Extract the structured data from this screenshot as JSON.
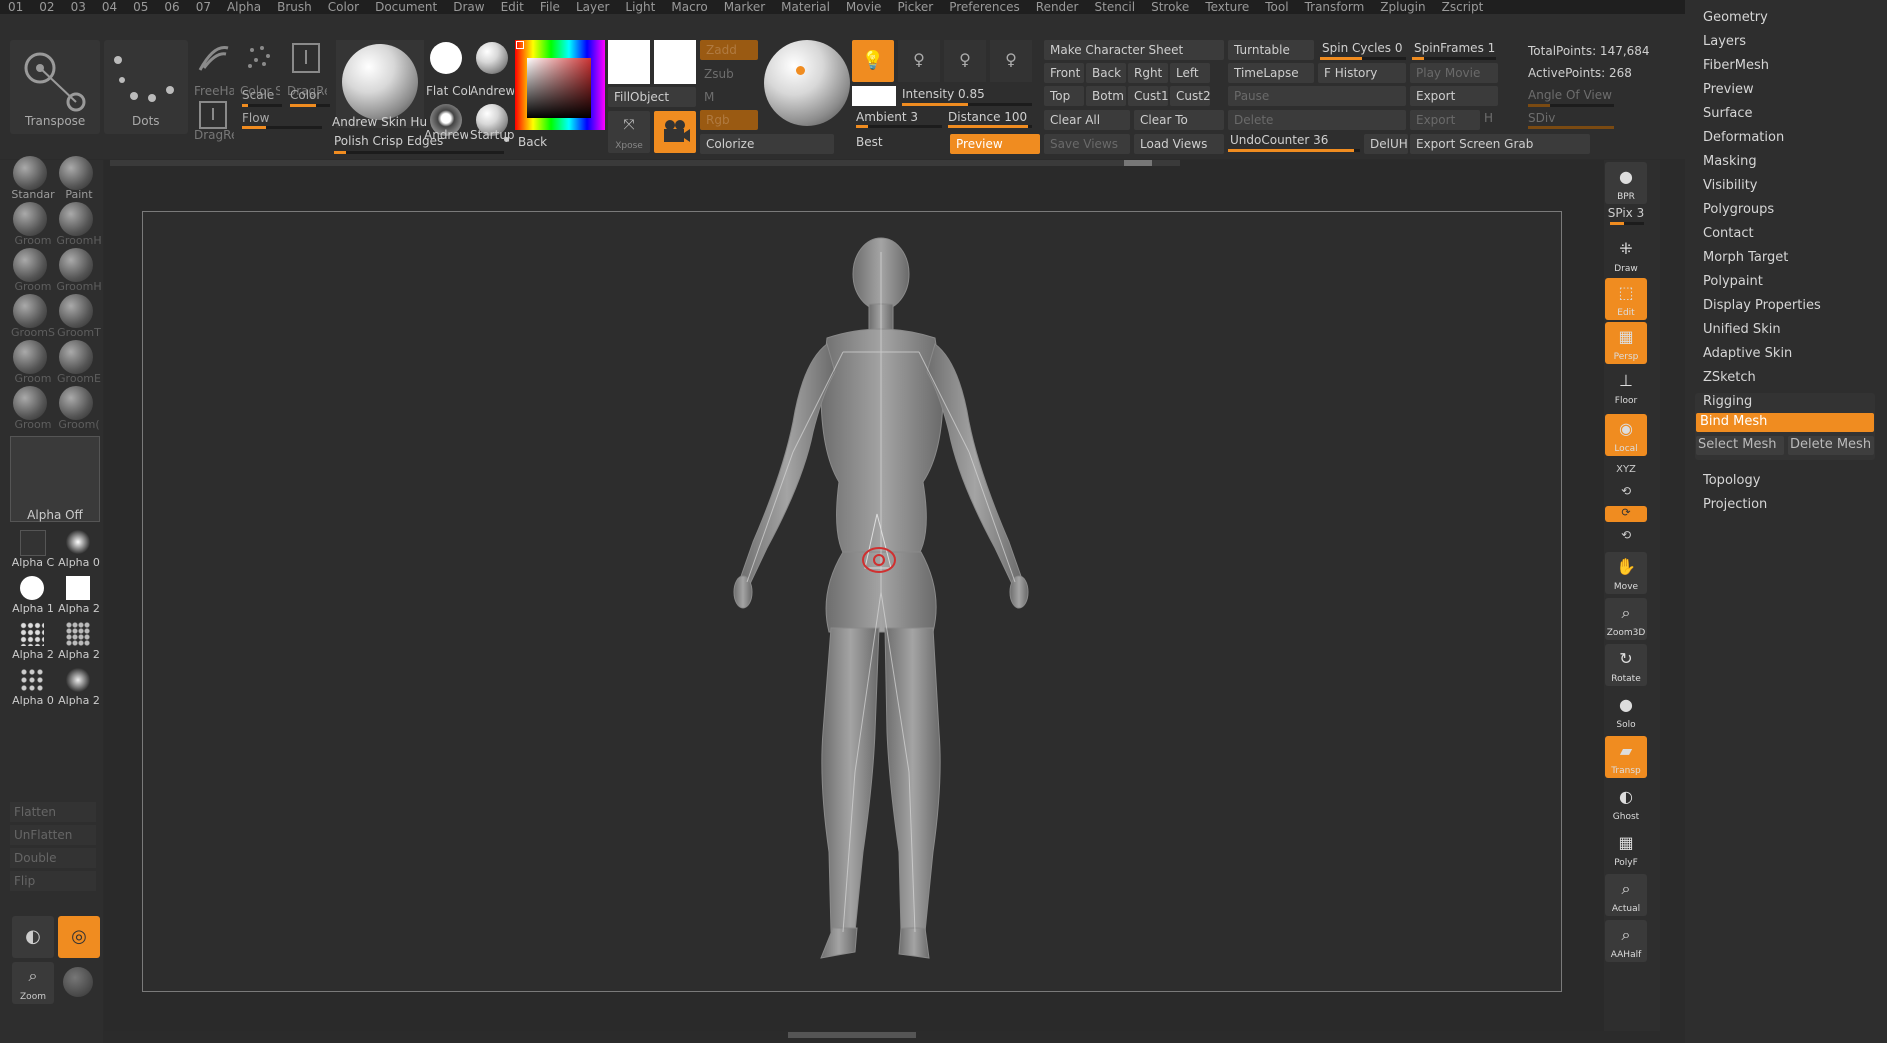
{
  "menubar": [
    "01",
    "02",
    "03",
    "04",
    "05",
    "06",
    "07",
    "Alpha",
    "Brush",
    "Color",
    "Document",
    "Draw",
    "Edit",
    "File",
    "Layer",
    "Light",
    "Macro",
    "Marker",
    "Material",
    "Movie",
    "Picker",
    "Preferences",
    "Render",
    "Stencil",
    "Stroke",
    "Texture",
    "Tool",
    "Transform",
    "Zplugin",
    "Zscript"
  ],
  "shelf": {
    "transpose": "Transpose",
    "dots": "Dots",
    "freehand": "FreeHai",
    "color_spray": "Color S|",
    "dragrect": "DragRe",
    "dragrect2": "DragRe",
    "scale": "Scale",
    "color": "Color",
    "flow": "Flow",
    "mat1": "Andrew Skin Hu",
    "mat2": "Flat Col",
    "mat3": "Andrew",
    "mat4": "Andrew",
    "mat5": "Startupl",
    "polish": "Polish Crisp Edges",
    "back": "Back",
    "fillobject": "FillObject",
    "zadd": "Zadd",
    "zsub": "Zsub",
    "m": "M",
    "rgb": "Rgb",
    "xpose": "Xpose",
    "colorize": "Colorize",
    "intensity": "Intensity 0.85",
    "ambient": "Ambient 3",
    "distance": "Distance 100",
    "best": "Best",
    "preview": "Preview",
    "make_sheet": "Make Character Sheet",
    "front": "Front",
    "back_view": "Back",
    "rght": "Rght",
    "left": "Left",
    "top": "Top",
    "botm": "Botm",
    "cust1": "Cust1",
    "cust2": "Cust2",
    "clear_all": "Clear All",
    "clear_to": "Clear To",
    "save_views": "Save Views",
    "load_views": "Load Views",
    "turntable": "Turntable",
    "spin_cycles": "Spin Cycles 0",
    "spinframes": "SpinFrames 1",
    "timelapse": "TimeLapse",
    "fhistory": "F History",
    "play_movie": "Play Movie",
    "pause": "Pause",
    "export1": "Export",
    "delete": "Delete",
    "export2": "Export",
    "h": "H",
    "undocounter": "UndoCounter 36",
    "deluh": "DelUH",
    "export_grab": "Export Screen Grab",
    "total_points": "TotalPoints: 147,684",
    "active_points": "ActivePoints: 268",
    "angle_of_view": "Angle Of View",
    "sdiv": "SDiv"
  },
  "left": {
    "brushes": [
      [
        "Standar",
        "Paint"
      ],
      [
        "Groom",
        "GroomH"
      ],
      [
        "Groom",
        "GroomH"
      ],
      [
        "GroomS",
        "GroomT"
      ],
      [
        "Groom",
        "GroomE"
      ],
      [
        "Groom",
        "Groom("
      ]
    ],
    "alpha_off": "Alpha Off",
    "alphas": [
      [
        "Alpha C",
        "Alpha 0"
      ],
      [
        "Alpha 1",
        "Alpha 2"
      ],
      [
        "Alpha 2",
        "Alpha 2"
      ],
      [
        "Alpha 0",
        "Alpha 2"
      ]
    ],
    "flatten": "Flatten",
    "unflatten": "UnFlatten",
    "double": "Double",
    "flip": "Flip",
    "zoom": "Zoom"
  },
  "right": {
    "bpr": "BPR",
    "spix": "SPix 3",
    "draw": "Draw",
    "edit": "Edit",
    "persp": "Persp",
    "floor": "Floor",
    "local": "Local",
    "xyz": "XYZ",
    "move": "Move",
    "zoom3d": "Zoom3D",
    "rotate": "Rotate",
    "solo": "Solo",
    "transp": "Transp",
    "ghost": "Ghost",
    "polyf": "PolyF",
    "actual": "Actual",
    "aahalf": "AAHalf"
  },
  "toolmenu": {
    "items": [
      "Geometry",
      "Layers",
      "FiberMesh",
      "Preview",
      "Surface",
      "Deformation",
      "Masking",
      "Visibility",
      "Polygroups",
      "Contact",
      "Morph Target",
      "Polypaint",
      "Display Properties",
      "Unified Skin",
      "Adaptive Skin",
      "ZSketch"
    ],
    "rigging": "Rigging",
    "bind_mesh": "Bind Mesh",
    "select_mesh": "Select Mesh",
    "delete_mesh": "Delete Mesh",
    "topology": "Topology",
    "projection": "Projection"
  },
  "colors": {
    "accent": "#f08c20",
    "panel": "#2e2e2e",
    "canvas": "#2d2d2d"
  }
}
